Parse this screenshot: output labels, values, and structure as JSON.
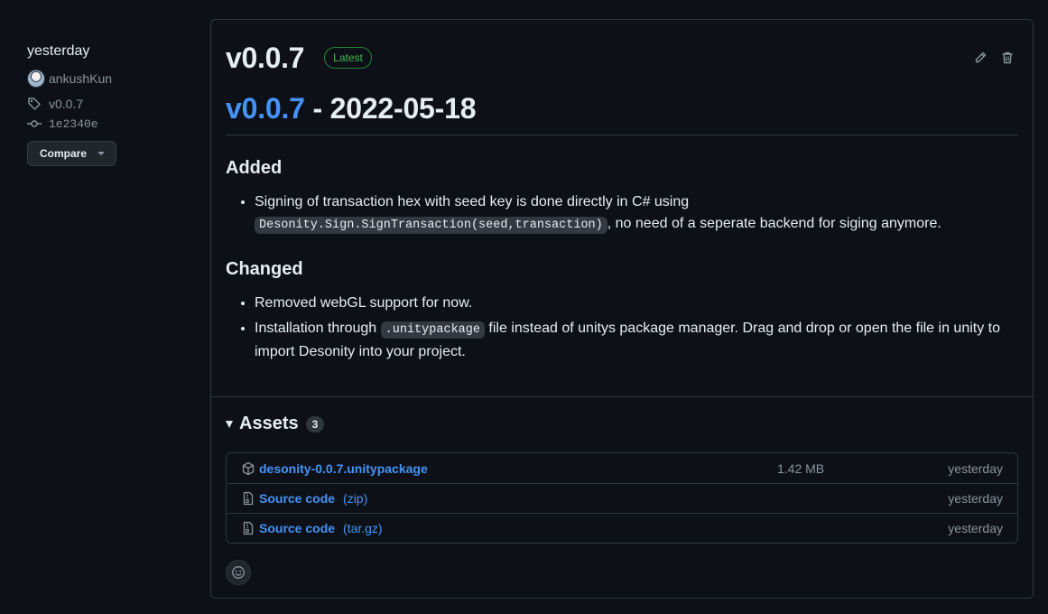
{
  "sidebar": {
    "date": "yesterday",
    "author": "ankushKun",
    "tag": "v0.0.7",
    "commit": "1e2340e",
    "compare_label": "Compare"
  },
  "release": {
    "title": "v0.0.7",
    "badge": "Latest",
    "subtitle_link": "v0.0.7",
    "subtitle_rest": " - 2022-05-18",
    "sections": {
      "added": {
        "heading": "Added",
        "item1_text1": "Signing of transaction hex with seed key is done directly in C# using ",
        "item1_code": "Desonity.Sign.SignTransaction(seed,transaction)",
        "item1_text2": ", no need of a seperate backend for siging anymore."
      },
      "changed": {
        "heading": "Changed",
        "item1": "Removed webGL support for now.",
        "item2_text1": "Installation through ",
        "item2_code": ".unitypackage",
        "item2_text2": " file instead of unitys package manager. Drag and drop or open the file in unity to import Desonity into your project."
      }
    }
  },
  "assets": {
    "heading": "Assets",
    "count": "3",
    "items": [
      {
        "name": "desonity-0.0.7.unitypackage",
        "ext": "",
        "size": "1.42 MB",
        "date": "yesterday",
        "icon": "package-icon"
      },
      {
        "name": "Source code",
        "ext": "(zip)",
        "size": "",
        "date": "yesterday",
        "icon": "file-zip-icon"
      },
      {
        "name": "Source code",
        "ext": "(tar.gz)",
        "size": "",
        "date": "yesterday",
        "icon": "file-zip-icon"
      }
    ]
  },
  "colors": {
    "background": "#0d1117",
    "link": "#4493f8",
    "latest": "#3fb950",
    "border": "#30363d"
  }
}
